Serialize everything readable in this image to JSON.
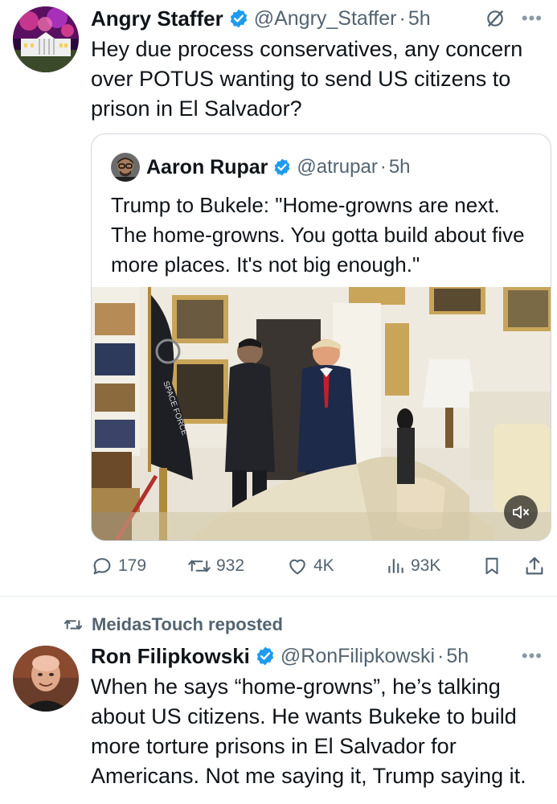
{
  "tweet1": {
    "author_name": "Angry Staffer",
    "handle": "@Angry_Staffer",
    "time": "5h",
    "text": "Hey due process conservatives, any concern over POTUS wanting to send US citizens to prison in El Salvador?",
    "quoted": {
      "author_name": "Aaron Rupar",
      "handle": "@atrupar",
      "time": "5h",
      "text": "Trump to Bukele: \"Home-growns are next. The home-growns. You gotta build about five more places. It's not big enough.\"",
      "flag_text": "SPACE FORCE"
    },
    "actions": {
      "replies": "179",
      "reposts": "932",
      "likes": "4K",
      "views": "93K"
    }
  },
  "tweet2": {
    "reposted_by": "MeidasTouch reposted",
    "author_name": "Ron Filipkowski",
    "handle": "@RonFilipkowski",
    "time": "5h",
    "text": "When he says “home-growns”, he’s talking about US citizens. He wants Bukeke to build more torture prisons in El Salvador for Americans. Not me saying it, Trump saying it."
  },
  "colors": {
    "verified_blue": "#1d9bf0",
    "secondary_text": "#536471",
    "primary_text": "#0f1419",
    "border": "#d0d7de"
  },
  "icons": [
    "verified-badge-icon",
    "grok-icon",
    "more-icon",
    "reply-icon",
    "repost-icon",
    "like-icon",
    "views-icon",
    "bookmark-icon",
    "share-icon",
    "mute-icon"
  ]
}
